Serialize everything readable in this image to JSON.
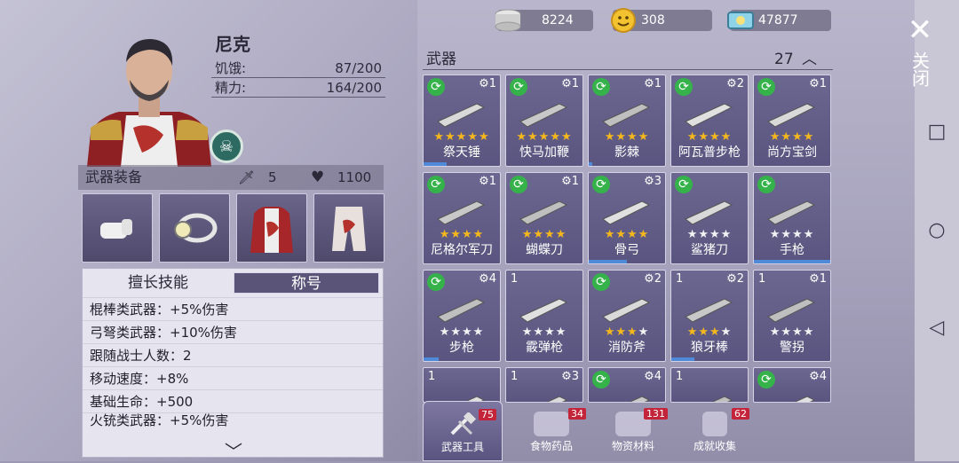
{
  "currency": [
    {
      "value": "8224",
      "icon": "coins-stack-icon",
      "color": "#d9d9d9"
    },
    {
      "value": "308",
      "icon": "smiley-coin-icon",
      "color": "#f2c230"
    },
    {
      "value": "47877",
      "icon": "ticket-icon",
      "color": "#8fd3e8"
    }
  ],
  "character": {
    "name": "尼克",
    "hunger_label": "饥饿:",
    "hunger_value": "87/200",
    "energy_label": "精力:",
    "energy_value": "164/200"
  },
  "equipment": {
    "title": "武器装备",
    "attack": "5",
    "health": "1100",
    "slots": [
      "fist-icon",
      "headlamp-icon",
      "armor-coat-icon",
      "pants-icon"
    ]
  },
  "skills": {
    "tabs": [
      "擅长技能",
      "称号"
    ],
    "lines": [
      "棍棒类武器：+5%伤害",
      "弓弩类武器：+10%伤害",
      "跟随战士人数：2",
      "移动速度：+8%",
      "基础生命：+500",
      "火铳类武器：+5%伤害"
    ]
  },
  "weapons": {
    "title": "武器",
    "count": "27",
    "items": [
      {
        "name": "祭天锤",
        "level": "1",
        "refresh": true,
        "stars": 5,
        "bar": 0.3
      },
      {
        "name": "快马加鞭",
        "level": "1",
        "refresh": true,
        "stars": 5,
        "bar": 0.0
      },
      {
        "name": "影棘",
        "level": "1",
        "refresh": true,
        "stars": 4,
        "bar": 0.05
      },
      {
        "name": "阿瓦普步枪",
        "level": "2",
        "refresh": true,
        "stars": 4,
        "bar": 0.0
      },
      {
        "name": "尚方宝剑",
        "level": "1",
        "refresh": true,
        "stars": 4,
        "bar": 0.0
      },
      {
        "name": "尼格尔军刀",
        "level": "1",
        "refresh": true,
        "stars": 4,
        "bar": 0.0
      },
      {
        "name": "蝴蝶刀",
        "level": "1",
        "refresh": true,
        "stars": 4,
        "bar": 0.0
      },
      {
        "name": "骨弓",
        "level": "3",
        "refresh": true,
        "stars": 4,
        "bar": 0.5
      },
      {
        "name": "鲨猪刀",
        "level": "",
        "refresh": true,
        "stars": 3,
        "bar": 0.0
      },
      {
        "name": "手枪",
        "level": "",
        "refresh": true,
        "stars": 3,
        "bar": 1.0
      },
      {
        "name": "步枪",
        "level": "4",
        "refresh": true,
        "stars": 3,
        "bar": 0.2
      },
      {
        "name": "霰弹枪",
        "level_left": "1",
        "stars": 3,
        "bar": 0.0
      },
      {
        "name": "消防斧",
        "level": "2",
        "refresh": true,
        "stars": 3,
        "bar": 0.0
      },
      {
        "name": "狼牙棒",
        "level": "2",
        "level_left": "1",
        "stars": 3,
        "bar": 0.3
      },
      {
        "name": "警拐",
        "level": "1",
        "level_left": "1",
        "stars": 2,
        "bar": 0.0
      },
      {
        "name": "",
        "level_left": "1",
        "stars": 0,
        "bar": 0.0
      },
      {
        "name": "",
        "level": "3",
        "level_left": "1",
        "stars": 0,
        "bar": 0.0
      },
      {
        "name": "",
        "level": "4",
        "refresh": true,
        "stars": 0,
        "bar": 0.0
      },
      {
        "name": "",
        "level_left": "1",
        "stars": 0,
        "bar": 0.0
      },
      {
        "name": "",
        "level": "4",
        "refresh": true,
        "stars": 0,
        "bar": 0.0
      }
    ]
  },
  "bottom_tabs": [
    {
      "label": "武器工具",
      "count": "75",
      "icon": "tools-icon"
    },
    {
      "label": "食物药品",
      "count": "34",
      "icon": "meat-icon"
    },
    {
      "label": "物资材料",
      "count": "131",
      "icon": "logs-icon"
    },
    {
      "label": "成就收集",
      "count": "62",
      "icon": "trophy-icon"
    }
  ],
  "close": {
    "label": "关闭"
  }
}
